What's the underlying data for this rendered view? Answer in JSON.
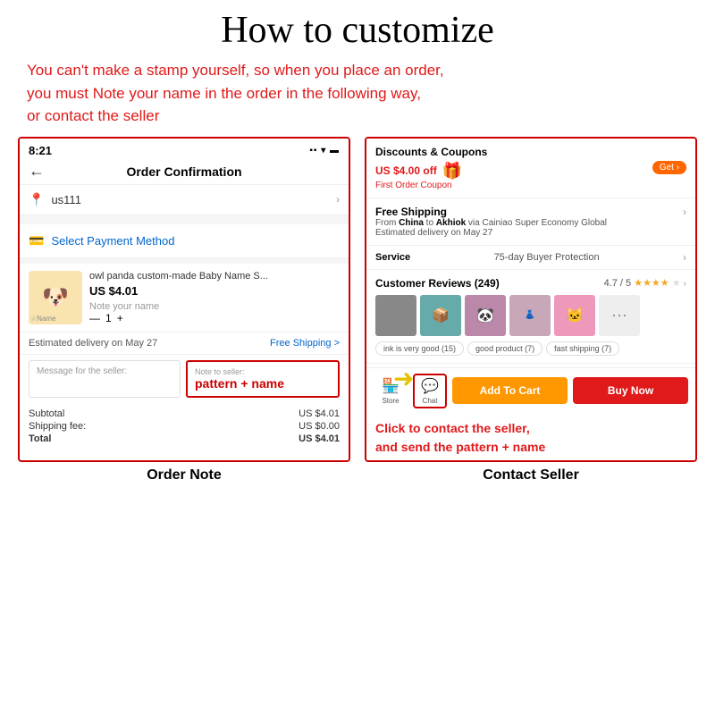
{
  "page": {
    "title": "How to customize",
    "subtitle_lines": [
      "You can't make a stamp yourself, so when you place an order,",
      "you must Note your name in the order in the following way,",
      "or contact the seller"
    ]
  },
  "left_panel": {
    "label": "Order Note",
    "status_time": "8:21",
    "status_icons": "▪▪ ▾ ▬",
    "header_title": "Order Confirmation",
    "back_arrow": "←",
    "address": "us111",
    "chevron": "›",
    "payment_text": "Select Payment Method",
    "product_name": "owl panda custom-made Baby Name S...",
    "product_price": "US $4.01",
    "product_note_placeholder": "Note your name",
    "quantity": "1",
    "delivery_info": "Estimated delivery on May 27",
    "free_shipping": "Free Shipping",
    "message_placeholder": "Message for the seller:",
    "note_placeholder": "Note to seller:",
    "note_pattern": "pattern + name",
    "subtotal_label": "Subtotal",
    "subtotal_value": "US $4.01",
    "shipping_label": "Shipping fee:",
    "shipping_value": "US $0.00",
    "total_label": "Total",
    "total_value": "US $4.01"
  },
  "right_panel": {
    "label": "Contact Seller",
    "discounts_title": "Discounts & Coupons",
    "get_btn": "Get ›",
    "discount_amount": "US $4.00 off",
    "coupon_label": "First Order Coupon",
    "shipping_title": "Free Shipping",
    "shipping_route": "From China to Akhiok via Cainiao Super Economy Global",
    "shipping_delivery": "Estimated delivery on May 27",
    "service_label": "Service",
    "service_value": "75-day Buyer Protection",
    "reviews_title": "Customer Reviews (249)",
    "reviews_rating": "4.7 / 5",
    "review_tags": [
      "ink is very good (15)",
      "good product (7)",
      "fast shipping (7)"
    ],
    "add_to_cart": "Add To Cart",
    "buy_now": "Buy Now",
    "store_label": "Store",
    "chat_label": "Chat",
    "click_annotation_line1": "Click to contact the seller,",
    "click_annotation_line2": "and send the",
    "pattern_text": "pattern + name"
  }
}
